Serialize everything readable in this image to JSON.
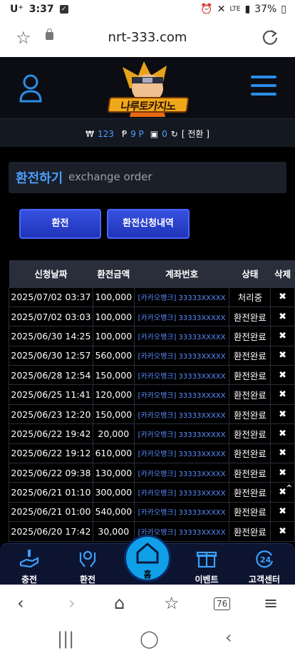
{
  "statusbar": {
    "carrier": "U⁺",
    "time": "3:37",
    "battery": "37%",
    "net": "LTE"
  },
  "browser": {
    "url": "nrt-333.com",
    "tab_count": "76"
  },
  "site": {
    "logo_text": "나루토카지노"
  },
  "balance": {
    "won_symbol": "₩",
    "won": "123",
    "point_symbol": "Ᵽ",
    "point": "9 P",
    "coupon": "0",
    "switch_label": "[ 전환 ]"
  },
  "page": {
    "title_ko": "환전하기",
    "title_en": "exchange order"
  },
  "buttons": {
    "exchange": "환전",
    "history": "환전신청내역"
  },
  "table": {
    "headers": [
      "신청날짜",
      "환전금액",
      "계좌번호",
      "상태",
      "삭제"
    ],
    "rows": [
      [
        "2025/07/02 03:37",
        "100,000",
        "[카카오뱅크] 33333XXXXX",
        "처리중",
        "✖"
      ],
      [
        "2025/07/02 03:03",
        "100,000",
        "[카카오뱅크] 33333XXXXX",
        "환전완료",
        "✖"
      ],
      [
        "2025/06/30 14:25",
        "100,000",
        "[카카오뱅크] 33333XXXXX",
        "환전완료",
        "✖"
      ],
      [
        "2025/06/30 12:57",
        "560,000",
        "[카카오뱅크] 33333XXXXX",
        "환전완료",
        "✖"
      ],
      [
        "2025/06/28 12:54",
        "150,000",
        "[카카오뱅크] 33333XXXXX",
        "환전완료",
        "✖"
      ],
      [
        "2025/06/25 11:41",
        "120,000",
        "[카카오뱅크] 33333XXXXX",
        "환전완료",
        "✖"
      ],
      [
        "2025/06/23 12:20",
        "150,000",
        "[카카오뱅크] 33333XXXXX",
        "환전완료",
        "✖"
      ],
      [
        "2025/06/22 19:42",
        "20,000",
        "[카카오뱅크] 33333XXXXX",
        "환전완료",
        "✖"
      ],
      [
        "2025/06/22 19:12",
        "610,000",
        "[카카오뱅크] 33333XXXXX",
        "환전완료",
        "✖"
      ],
      [
        "2025/06/22 09:38",
        "130,000",
        "[카카오뱅크] 33333XXXXX",
        "환전완료",
        "✖"
      ],
      [
        "2025/06/21 01:10",
        "300,000",
        "[카카오뱅크] 33333XXXXX",
        "환전완료",
        "✖"
      ],
      [
        "2025/06/21 01:00",
        "540,000",
        "[카카오뱅크] 33333XXXXX",
        "환전완료",
        "✖"
      ],
      [
        "2025/06/20 17:42",
        "30,000",
        "[카카오뱅크] 33333XXXXX",
        "환전완료",
        "✖"
      ]
    ]
  },
  "bottom_nav": {
    "deposit": "충전",
    "withdraw": "환전",
    "home": "홈",
    "event": "이벤트",
    "support": "고객센터"
  },
  "colors": {
    "accent": "#4d9dff",
    "button": "#2a44d0",
    "home": "#0fa0e8"
  }
}
